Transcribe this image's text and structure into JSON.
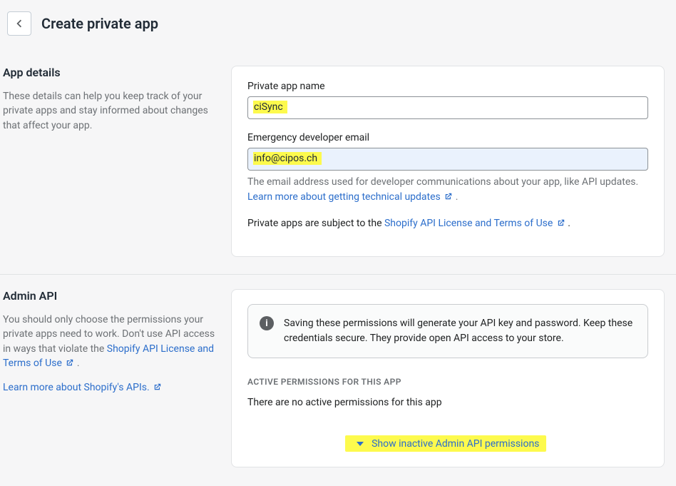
{
  "header": {
    "title": "Create private app"
  },
  "sections": {
    "appDetails": {
      "title": "App details",
      "desc": "These details can help you keep track of your private apps and stay informed about changes that affect your app.",
      "fields": {
        "nameLabel": "Private app name",
        "nameValue": "ciSync",
        "emailLabel": "Emergency developer email",
        "emailValue": "info@cipos.ch",
        "emailHelpPrefix": "The email address used for developer communications about your app, like API updates. ",
        "emailHelpLink": "Learn more about getting technical updates",
        "apiNoticePrefix": "Private apps are subject to the ",
        "apiNoticeLink": "Shopify API License and Terms of Use"
      }
    },
    "adminApi": {
      "title": "Admin API",
      "descPrefix": "You should only choose the permissions your private apps need to work. Don't use API access in ways that violate the ",
      "descLink": "Shopify API License and Terms of Use",
      "learnLink": "Learn more about Shopify's APIs.",
      "bannerText": "Saving these permissions will generate your API key and password. Keep these credentials secure. They provide open API access to your store.",
      "permTitle": "ACTIVE PERMISSIONS FOR THIS APP",
      "permEmpty": "There are no active permissions for this app",
      "showInactive": "Show inactive Admin API permissions"
    }
  },
  "punct": {
    "period": "."
  }
}
